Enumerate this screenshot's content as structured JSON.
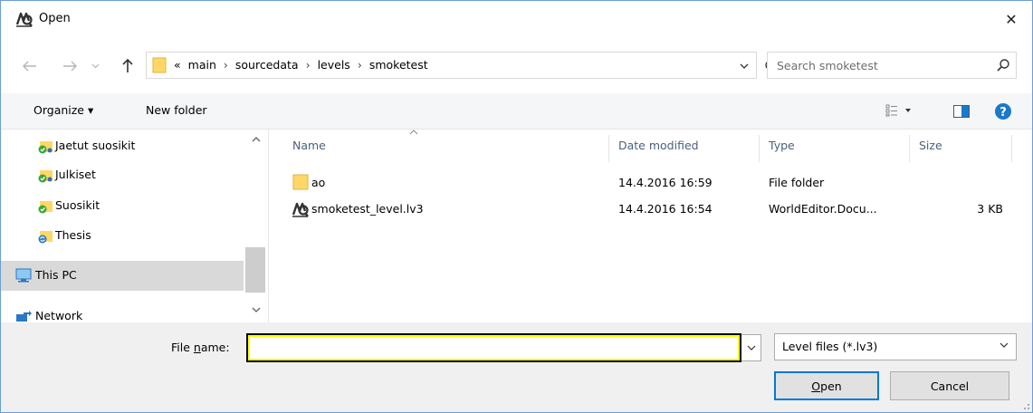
{
  "window": {
    "title": "Open",
    "close_glyph": "✕"
  },
  "address": {
    "overflow_glyph": "«",
    "crumbs": [
      "main",
      "sourcedata",
      "levels",
      "smoketest"
    ],
    "separator": "›"
  },
  "search": {
    "placeholder": "Search smoketest"
  },
  "toolbar": {
    "organize_label": "Organize ▾",
    "new_folder_label": "New folder"
  },
  "nav": {
    "items": [
      {
        "label": "Jaetut suosikit",
        "icon": "shared-favorites-icon"
      },
      {
        "label": "Julkiset",
        "icon": "public-folder-icon"
      },
      {
        "label": "Suosikit",
        "icon": "favorites-icon"
      },
      {
        "label": "Thesis",
        "icon": "sync-folder-icon"
      },
      {
        "label": "This PC",
        "icon": "computer-icon"
      },
      {
        "label": "Network",
        "icon": "network-icon"
      }
    ]
  },
  "files": {
    "columns": {
      "name": "Name",
      "date": "Date modified",
      "type": "Type",
      "size": "Size"
    },
    "rows": [
      {
        "name": "ao",
        "date": "14.4.2016 16:59",
        "type": "File folder",
        "size": "",
        "icon": "folder-icon"
      },
      {
        "name": "smoketest_level.lv3",
        "date": "14.4.2016 16:54",
        "type": "WorldEditor.Docu...",
        "size": "3 KB",
        "icon": "worldeditor-file-icon"
      }
    ]
  },
  "bottom": {
    "file_name_label_pre": "File ",
    "file_name_label_underlined": "n",
    "file_name_label_post": "ame:",
    "file_name_value": "",
    "file_type_selected": "Level files (*.lv3)",
    "open_label_underlined": "O",
    "open_label_rest": "pen",
    "cancel_label": "Cancel"
  },
  "colors": {
    "accent": "#0078d7",
    "folder": "#ffd766",
    "selection": "#d9d9d9",
    "help": "#1979ca"
  }
}
